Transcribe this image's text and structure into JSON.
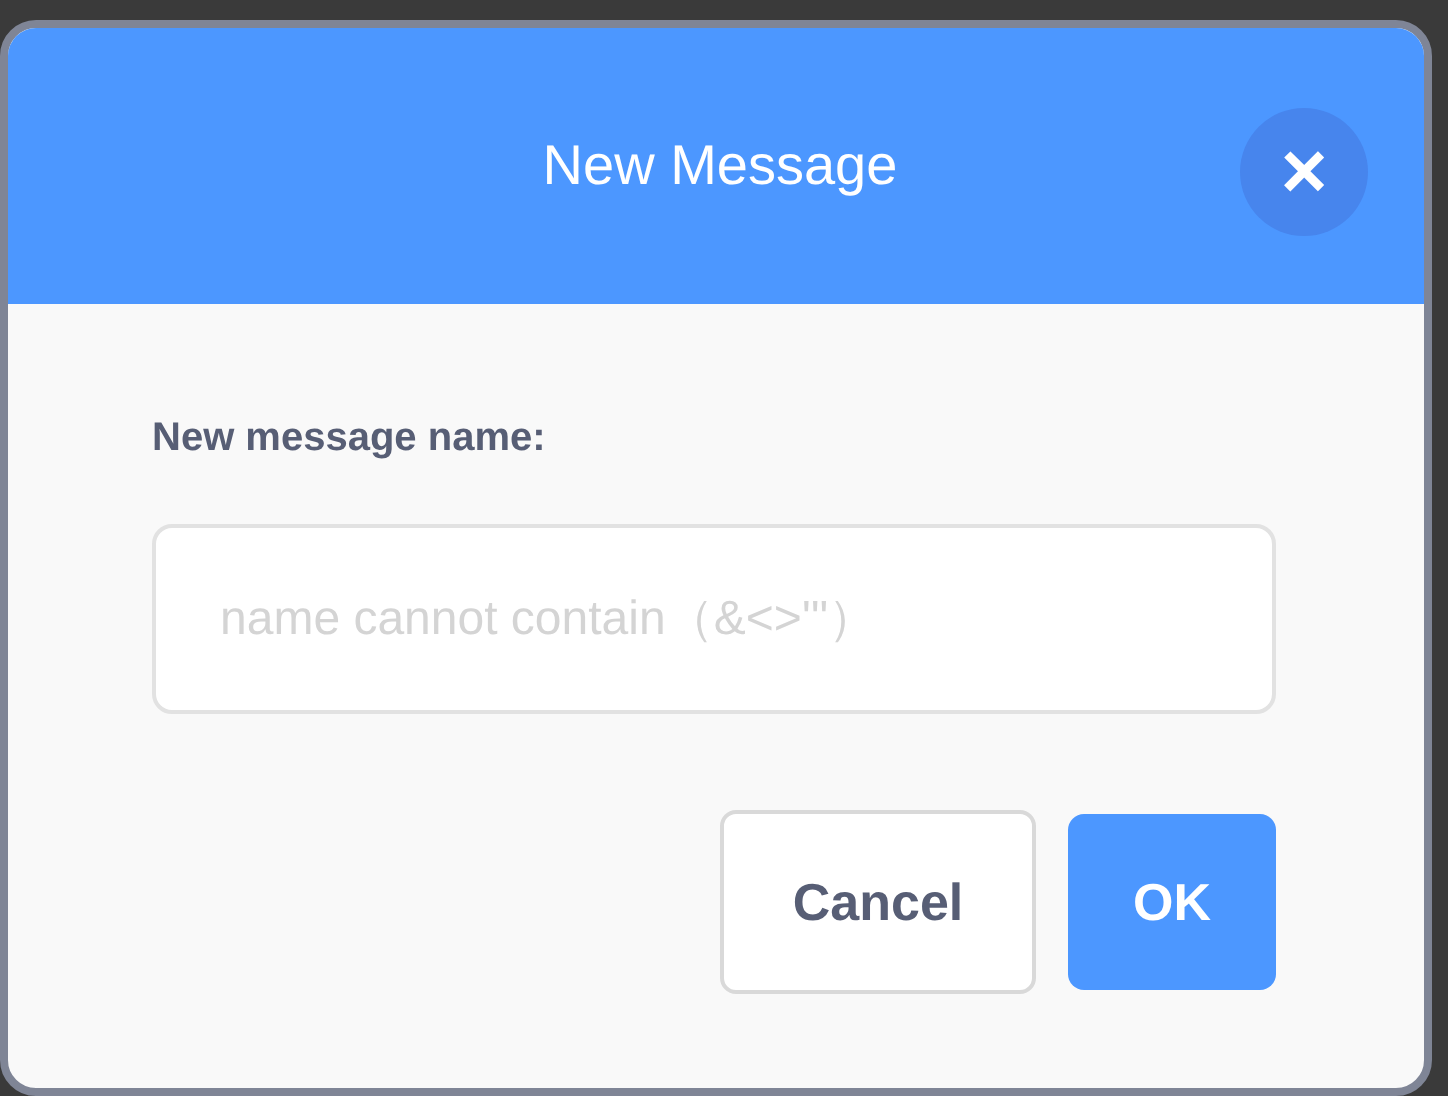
{
  "dialog": {
    "title": "New Message",
    "close": "×"
  },
  "field": {
    "label": "New message name:",
    "placeholder": "name cannot contain（&<>'\"）"
  },
  "buttons": [
    {
      "label": "Cancel",
      "kind": "secondary"
    },
    {
      "label": "OK",
      "kind": "primary"
    }
  ]
}
